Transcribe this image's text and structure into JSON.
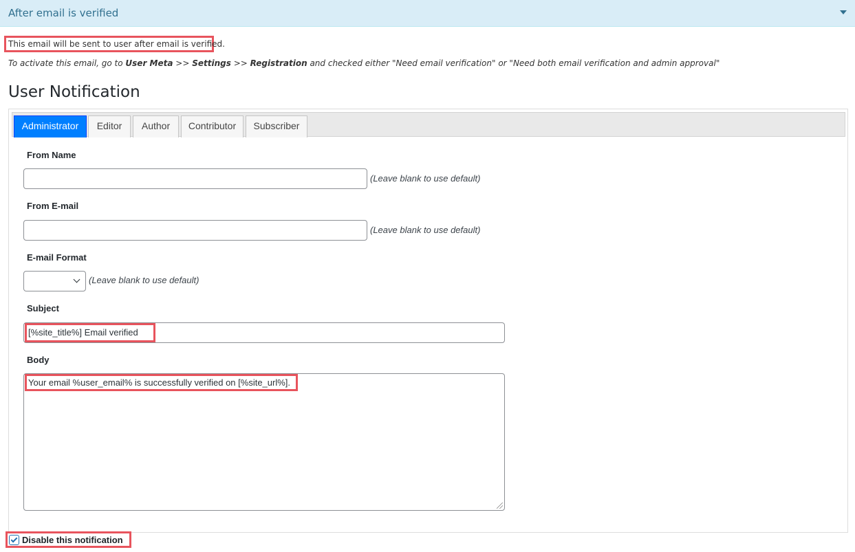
{
  "header": {
    "title": "After email is verified",
    "caret_icon": "caret-down-icon"
  },
  "info_text": "This email will be sent to user after email is verified.",
  "activation_note": {
    "prefix": "To activate this email, go to ",
    "link1": "User Meta",
    "sep1": " >> ",
    "link2": "Settings",
    "sep2": " >> ",
    "link3": "Registration",
    "suffix": " and checked either \"Need email verification\" or \"Need both email verification and admin approval\""
  },
  "section_title": "User Notification",
  "tabs": [
    {
      "label": "Administrator",
      "active": true
    },
    {
      "label": "Editor",
      "active": false
    },
    {
      "label": "Author",
      "active": false
    },
    {
      "label": "Contributor",
      "active": false
    },
    {
      "label": "Subscriber",
      "active": false
    }
  ],
  "form": {
    "from_name": {
      "label": "From Name",
      "value": "",
      "hint": "(Leave blank to use default)"
    },
    "from_email": {
      "label": "From E-mail",
      "value": "",
      "hint": "(Leave blank to use default)"
    },
    "email_format": {
      "label": "E-mail Format",
      "value": "",
      "hint": "(Leave blank to use default)"
    },
    "subject": {
      "label": "Subject",
      "value": "[%site_title%] Email verified"
    },
    "body": {
      "label": "Body",
      "value": "Your email %user_email% is successfully verified on [%site_url%]."
    }
  },
  "disable_checkbox": {
    "label": "Disable this notification",
    "checked": true
  },
  "colors": {
    "highlight": "#e8545d",
    "active_tab": "#007fff",
    "header_bg": "#d9edf7"
  }
}
